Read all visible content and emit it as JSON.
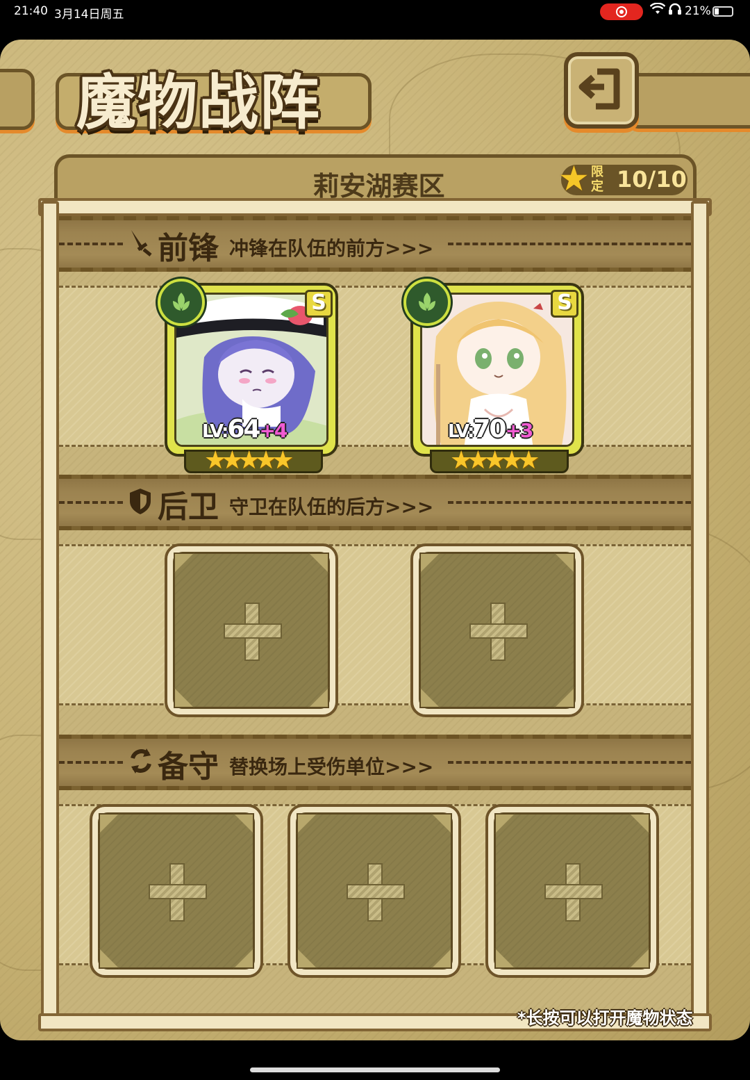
{
  "status_bar": {
    "time": "21:40",
    "date": "3月14日周五",
    "battery": "21%",
    "icons": [
      "screen-record-icon",
      "wifi-icon",
      "headset-icon",
      "battery-icon"
    ]
  },
  "header": {
    "title": "魔物战阵",
    "back_icon": "return-arrow-icon"
  },
  "panel": {
    "region_name": "莉安湖赛区",
    "limit_label": "限定",
    "limit_count": "10/10"
  },
  "sections": {
    "front": {
      "title": "前锋",
      "desc": "冲锋在队伍的前方>>>",
      "icon": "sword-icon"
    },
    "back": {
      "title": "后卫",
      "desc": "守卫在队伍的后方>>>",
      "icon": "shield-icon"
    },
    "reserve": {
      "title": "备守",
      "desc": "替换场上受伤单位>>>",
      "icon": "swap-icon"
    }
  },
  "monsters": [
    {
      "rank": "S",
      "level_tag": "LV:",
      "level": "64",
      "bonus": "+4",
      "stars": 5,
      "element": "leaf-icon"
    },
    {
      "rank": "S",
      "level_tag": "LV:",
      "level": "70",
      "bonus": "+3",
      "stars": 5,
      "element": "leaf-icon"
    }
  ],
  "empty_slot_icon": "plus-icon",
  "tip": "*长按可以打开魔物状态",
  "colors": {
    "accent_orange": "#e58a2b",
    "card_yellow": "#e0e34b",
    "bonus_pink": "#f05bd2",
    "star_gold": "#f9c62a"
  }
}
